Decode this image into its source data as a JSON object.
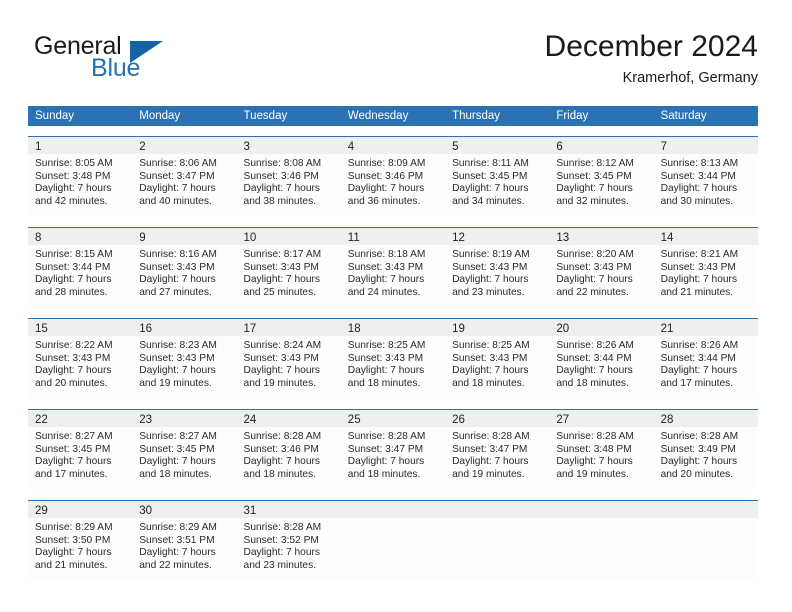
{
  "brand": {
    "name_part1": "General",
    "name_part2": "Blue",
    "accent_color": "#2572b6",
    "triangle_color": "#1464a5"
  },
  "header": {
    "month_title": "December 2024",
    "location": "Kramerhof, Germany"
  },
  "calendar": {
    "header_background": "#2b72b5",
    "row_border_color": "#2b72b5",
    "daynum_band_color": "#efefef",
    "weekday_headers": [
      "Sunday",
      "Monday",
      "Tuesday",
      "Wednesday",
      "Thursday",
      "Friday",
      "Saturday"
    ],
    "weeks": [
      [
        {
          "day": "1",
          "sunrise": "Sunrise: 8:05 AM",
          "sunset": "Sunset: 3:48 PM",
          "daylight_line1": "Daylight: 7 hours",
          "daylight_line2": "and 42 minutes."
        },
        {
          "day": "2",
          "sunrise": "Sunrise: 8:06 AM",
          "sunset": "Sunset: 3:47 PM",
          "daylight_line1": "Daylight: 7 hours",
          "daylight_line2": "and 40 minutes."
        },
        {
          "day": "3",
          "sunrise": "Sunrise: 8:08 AM",
          "sunset": "Sunset: 3:46 PM",
          "daylight_line1": "Daylight: 7 hours",
          "daylight_line2": "and 38 minutes."
        },
        {
          "day": "4",
          "sunrise": "Sunrise: 8:09 AM",
          "sunset": "Sunset: 3:46 PM",
          "daylight_line1": "Daylight: 7 hours",
          "daylight_line2": "and 36 minutes."
        },
        {
          "day": "5",
          "sunrise": "Sunrise: 8:11 AM",
          "sunset": "Sunset: 3:45 PM",
          "daylight_line1": "Daylight: 7 hours",
          "daylight_line2": "and 34 minutes."
        },
        {
          "day": "6",
          "sunrise": "Sunrise: 8:12 AM",
          "sunset": "Sunset: 3:45 PM",
          "daylight_line1": "Daylight: 7 hours",
          "daylight_line2": "and 32 minutes."
        },
        {
          "day": "7",
          "sunrise": "Sunrise: 8:13 AM",
          "sunset": "Sunset: 3:44 PM",
          "daylight_line1": "Daylight: 7 hours",
          "daylight_line2": "and 30 minutes."
        }
      ],
      [
        {
          "day": "8",
          "sunrise": "Sunrise: 8:15 AM",
          "sunset": "Sunset: 3:44 PM",
          "daylight_line1": "Daylight: 7 hours",
          "daylight_line2": "and 28 minutes."
        },
        {
          "day": "9",
          "sunrise": "Sunrise: 8:16 AM",
          "sunset": "Sunset: 3:43 PM",
          "daylight_line1": "Daylight: 7 hours",
          "daylight_line2": "and 27 minutes."
        },
        {
          "day": "10",
          "sunrise": "Sunrise: 8:17 AM",
          "sunset": "Sunset: 3:43 PM",
          "daylight_line1": "Daylight: 7 hours",
          "daylight_line2": "and 25 minutes."
        },
        {
          "day": "11",
          "sunrise": "Sunrise: 8:18 AM",
          "sunset": "Sunset: 3:43 PM",
          "daylight_line1": "Daylight: 7 hours",
          "daylight_line2": "and 24 minutes."
        },
        {
          "day": "12",
          "sunrise": "Sunrise: 8:19 AM",
          "sunset": "Sunset: 3:43 PM",
          "daylight_line1": "Daylight: 7 hours",
          "daylight_line2": "and 23 minutes."
        },
        {
          "day": "13",
          "sunrise": "Sunrise: 8:20 AM",
          "sunset": "Sunset: 3:43 PM",
          "daylight_line1": "Daylight: 7 hours",
          "daylight_line2": "and 22 minutes."
        },
        {
          "day": "14",
          "sunrise": "Sunrise: 8:21 AM",
          "sunset": "Sunset: 3:43 PM",
          "daylight_line1": "Daylight: 7 hours",
          "daylight_line2": "and 21 minutes."
        }
      ],
      [
        {
          "day": "15",
          "sunrise": "Sunrise: 8:22 AM",
          "sunset": "Sunset: 3:43 PM",
          "daylight_line1": "Daylight: 7 hours",
          "daylight_line2": "and 20 minutes."
        },
        {
          "day": "16",
          "sunrise": "Sunrise: 8:23 AM",
          "sunset": "Sunset: 3:43 PM",
          "daylight_line1": "Daylight: 7 hours",
          "daylight_line2": "and 19 minutes."
        },
        {
          "day": "17",
          "sunrise": "Sunrise: 8:24 AM",
          "sunset": "Sunset: 3:43 PM",
          "daylight_line1": "Daylight: 7 hours",
          "daylight_line2": "and 19 minutes."
        },
        {
          "day": "18",
          "sunrise": "Sunrise: 8:25 AM",
          "sunset": "Sunset: 3:43 PM",
          "daylight_line1": "Daylight: 7 hours",
          "daylight_line2": "and 18 minutes."
        },
        {
          "day": "19",
          "sunrise": "Sunrise: 8:25 AM",
          "sunset": "Sunset: 3:43 PM",
          "daylight_line1": "Daylight: 7 hours",
          "daylight_line2": "and 18 minutes."
        },
        {
          "day": "20",
          "sunrise": "Sunrise: 8:26 AM",
          "sunset": "Sunset: 3:44 PM",
          "daylight_line1": "Daylight: 7 hours",
          "daylight_line2": "and 18 minutes."
        },
        {
          "day": "21",
          "sunrise": "Sunrise: 8:26 AM",
          "sunset": "Sunset: 3:44 PM",
          "daylight_line1": "Daylight: 7 hours",
          "daylight_line2": "and 17 minutes."
        }
      ],
      [
        {
          "day": "22",
          "sunrise": "Sunrise: 8:27 AM",
          "sunset": "Sunset: 3:45 PM",
          "daylight_line1": "Daylight: 7 hours",
          "daylight_line2": "and 17 minutes."
        },
        {
          "day": "23",
          "sunrise": "Sunrise: 8:27 AM",
          "sunset": "Sunset: 3:45 PM",
          "daylight_line1": "Daylight: 7 hours",
          "daylight_line2": "and 18 minutes."
        },
        {
          "day": "24",
          "sunrise": "Sunrise: 8:28 AM",
          "sunset": "Sunset: 3:46 PM",
          "daylight_line1": "Daylight: 7 hours",
          "daylight_line2": "and 18 minutes."
        },
        {
          "day": "25",
          "sunrise": "Sunrise: 8:28 AM",
          "sunset": "Sunset: 3:47 PM",
          "daylight_line1": "Daylight: 7 hours",
          "daylight_line2": "and 18 minutes."
        },
        {
          "day": "26",
          "sunrise": "Sunrise: 8:28 AM",
          "sunset": "Sunset: 3:47 PM",
          "daylight_line1": "Daylight: 7 hours",
          "daylight_line2": "and 19 minutes."
        },
        {
          "day": "27",
          "sunrise": "Sunrise: 8:28 AM",
          "sunset": "Sunset: 3:48 PM",
          "daylight_line1": "Daylight: 7 hours",
          "daylight_line2": "and 19 minutes."
        },
        {
          "day": "28",
          "sunrise": "Sunrise: 8:28 AM",
          "sunset": "Sunset: 3:49 PM",
          "daylight_line1": "Daylight: 7 hours",
          "daylight_line2": "and 20 minutes."
        }
      ],
      [
        {
          "day": "29",
          "sunrise": "Sunrise: 8:29 AM",
          "sunset": "Sunset: 3:50 PM",
          "daylight_line1": "Daylight: 7 hours",
          "daylight_line2": "and 21 minutes."
        },
        {
          "day": "30",
          "sunrise": "Sunrise: 8:29 AM",
          "sunset": "Sunset: 3:51 PM",
          "daylight_line1": "Daylight: 7 hours",
          "daylight_line2": "and 22 minutes."
        },
        {
          "day": "31",
          "sunrise": "Sunrise: 8:28 AM",
          "sunset": "Sunset: 3:52 PM",
          "daylight_line1": "Daylight: 7 hours",
          "daylight_line2": "and 23 minutes."
        },
        {
          "day": "",
          "sunrise": "",
          "sunset": "",
          "daylight_line1": "",
          "daylight_line2": ""
        },
        {
          "day": "",
          "sunrise": "",
          "sunset": "",
          "daylight_line1": "",
          "daylight_line2": ""
        },
        {
          "day": "",
          "sunrise": "",
          "sunset": "",
          "daylight_line1": "",
          "daylight_line2": ""
        },
        {
          "day": "",
          "sunrise": "",
          "sunset": "",
          "daylight_line1": "",
          "daylight_line2": ""
        }
      ]
    ]
  }
}
